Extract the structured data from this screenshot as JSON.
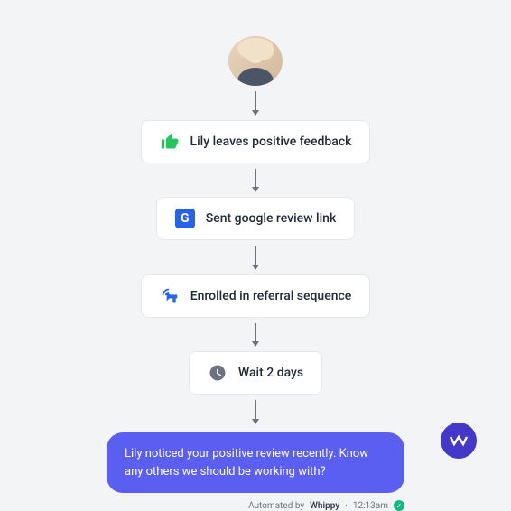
{
  "steps": [
    {
      "label": "Lily leaves positive feedback"
    },
    {
      "label": "Sent google review link"
    },
    {
      "label": "Enrolled in referral sequence"
    },
    {
      "label": "Wait 2 days"
    }
  ],
  "message": "Lily noticed your positive review recently. Know any others we should be working with?",
  "footer": {
    "prefix": "Automated by",
    "brand": "Whippy",
    "time": "12:13am"
  },
  "icons": {
    "google_letter": "G"
  }
}
